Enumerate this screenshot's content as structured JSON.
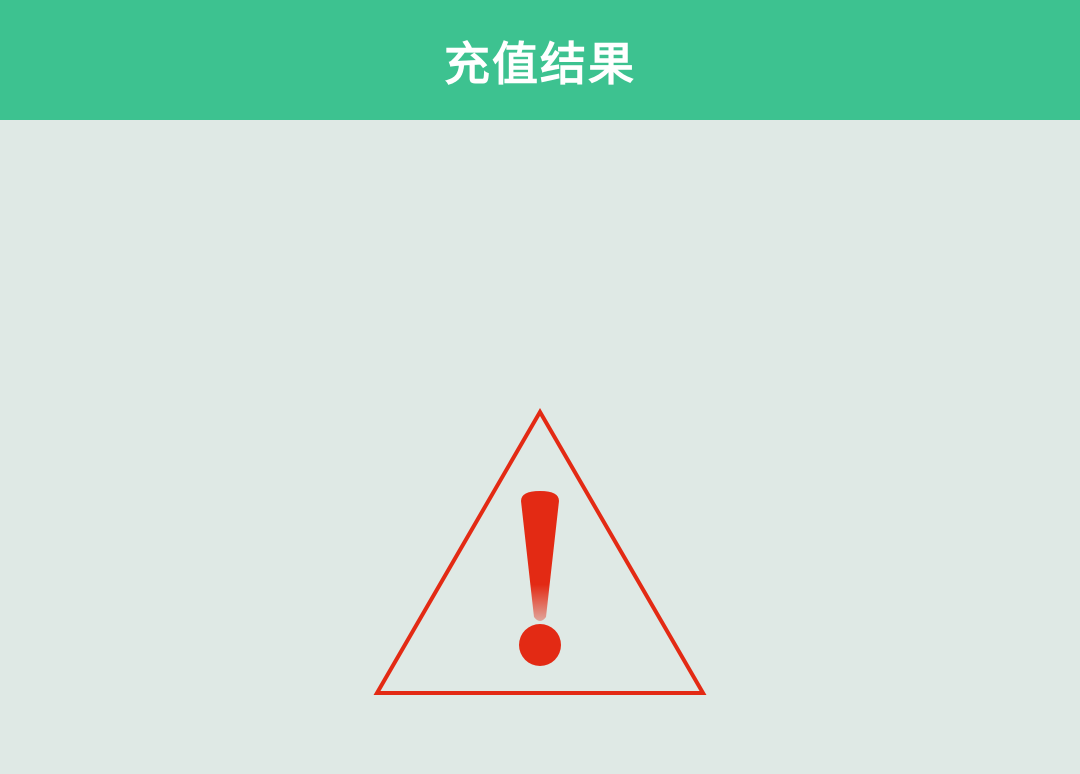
{
  "header": {
    "title": "充值结果"
  },
  "result": {
    "icon": "warning-icon",
    "status": "failure"
  },
  "colors": {
    "header_bg": "#3dc290",
    "page_bg": "#dfe9e5",
    "warning": "#e32a14"
  }
}
